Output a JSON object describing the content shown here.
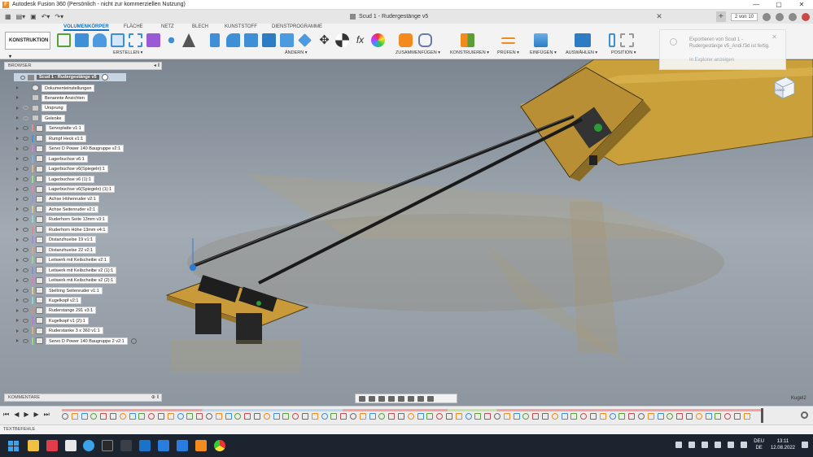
{
  "window": {
    "title": "Autodesk Fusion 360 (Persönlich - nicht zur kommerziellen Nutzung)",
    "controls": [
      "—",
      "▢",
      "✕"
    ]
  },
  "doc_tab": {
    "title": "Scud 1 - Rudergestänge v5",
    "close": "✕",
    "page_indicator": "2 von 10"
  },
  "toolbar": {
    "workspace": "KONSTRUKTION ▾",
    "tabs": [
      "VOLUMENKÖRPER",
      "FLÄCHE",
      "NETZ",
      "BLECH",
      "KUNSTSTOFF",
      "DIENSTPROGRAMME"
    ],
    "active_tab": "VOLUMENKÖRPER",
    "groups": [
      "ERSTELLEN ▾",
      "ÄNDERN ▾",
      "ZUSAMMENFÜGEN ▾",
      "KONSTRUIEREN ▾",
      "PRÜFEN ▾",
      "EINFÜGEN ▾",
      "AUSWÄHLEN ▾",
      "POSITION ▾"
    ],
    "fx_label": "fx"
  },
  "notification": {
    "message": "Exportieren von Scud 1 - Rudergestänge v5_Andi.f3d ist fertig.",
    "link": "In Explorer anzeigen",
    "close": "✕"
  },
  "browser": {
    "title": "BROWSER",
    "controls": "◂ ‖",
    "root_label": "Scud 1 - Rudergestänge v5",
    "items": [
      {
        "label": "Dokumenteinstellungen",
        "icon": "gear-icon",
        "eye": false,
        "color": ""
      },
      {
        "label": "Benannte Ansichten",
        "icon": "folder-icon",
        "eye": false,
        "color": ""
      },
      {
        "label": "Ursprung",
        "icon": "folder-icon",
        "eye": true,
        "eye_off": true,
        "color": ""
      },
      {
        "label": "Gelenke",
        "icon": "folder-icon",
        "eye": true,
        "eye_off": true,
        "color": ""
      },
      {
        "label": "Servoplatte v1:1",
        "icon": "component-icon",
        "eye": true,
        "color": "#e98a8a"
      },
      {
        "label": "Rumpf Heck v1:1",
        "icon": "component-icon",
        "eye": true,
        "color": "#4a8fd9"
      },
      {
        "label": "Servo D Power 140 Baugruppe v2:1",
        "icon": "component-icon",
        "eye": true,
        "color": "#d47fd9"
      },
      {
        "label": "Lagerbuchse v6:1",
        "icon": "component-icon",
        "eye": true,
        "color": "#7fb0e0"
      },
      {
        "label": "Lagerbuchse v6(Spiegeln):1",
        "icon": "component-icon",
        "eye": true,
        "color": "#e0b57f"
      },
      {
        "label": "Lagerbuchse v6 (1):1",
        "icon": "component-icon",
        "eye": true,
        "color": "#9ad98a"
      },
      {
        "label": "Lagerbuchse v6(Spiegeln) (1):1",
        "icon": "component-icon",
        "eye": true,
        "color": "#d98ab0"
      },
      {
        "label": "Achse Höhenruder v2:1",
        "icon": "component-icon",
        "eye": true,
        "color": "#8a9ad9"
      },
      {
        "label": "Achse Seitenruder v2:1",
        "icon": "component-icon",
        "eye": true,
        "color": "#d9c58a"
      },
      {
        "label": "Ruderhorn Seite 13mm v3:1",
        "icon": "component-icon",
        "eye": true,
        "color": "#8ad9c9"
      },
      {
        "label": "Ruderhorn Höhe 13mm v4:1",
        "icon": "component-icon",
        "eye": true,
        "color": "#d98a8a"
      },
      {
        "label": "Distanzhuelse 19 v1:1",
        "icon": "component-icon",
        "eye": true,
        "color": "#a58ad9"
      },
      {
        "label": "Distanzhuelse 22 v2:1",
        "icon": "component-icon",
        "eye": true,
        "color": "#d9a58a"
      },
      {
        "label": "Leitwerk mit Keilscheibe v2:1",
        "icon": "component-icon",
        "eye": true,
        "color": "#8ad99a"
      },
      {
        "label": "Leitwerk mit Keilscheibe v2 (1):1",
        "icon": "component-icon",
        "eye": true,
        "color": "#7f8fd9"
      },
      {
        "label": "Leitwerk mit Keilscheibe v2 (2):1",
        "icon": "component-icon",
        "eye": true,
        "color": "#d97fc3"
      },
      {
        "label": "Stellring Seitenruder v1:1",
        "icon": "component-icon",
        "eye": true,
        "color": "#d9cf7f"
      },
      {
        "label": "Kugelkopf v2:1",
        "icon": "component-icon",
        "eye": true,
        "color": "#7fd9d4"
      },
      {
        "label": "Ruderstange 291 v3:1",
        "icon": "component-icon",
        "eye": true,
        "color": "#d98a7f"
      },
      {
        "label": "Kugelkopf v1 (2):1",
        "icon": "component-icon",
        "eye": true,
        "color": "#b07fd9"
      },
      {
        "label": "Ruderstanke 3 x 360 v1:1",
        "icon": "component-icon",
        "eye": true,
        "color": "#d9b07f"
      },
      {
        "label": "Servo D Power 140 Baugruppe 2 v2:1",
        "icon": "component-icon",
        "eye": true,
        "color": "#8fd97f",
        "extra": true
      }
    ]
  },
  "viewcube_label": "LINKS",
  "comments": {
    "title": "KOMMENTARE",
    "control": "⊕ ‖"
  },
  "status_right": "Kugel2",
  "timeline": {
    "controls": [
      "⏮",
      "◀",
      "▶",
      "▶",
      "⏭"
    ]
  },
  "text_commands": {
    "label": "TEXTBEFEHLE"
  },
  "taskbar": {
    "lang_1": "DEU",
    "lang_2": "DE",
    "time": "13:11",
    "date": "12.08.2022"
  },
  "colors": {
    "accent": "#0a74c9",
    "wood": "#c99a3a",
    "viewport_bg": "#8d969f",
    "taskbar": "#1c2430"
  }
}
